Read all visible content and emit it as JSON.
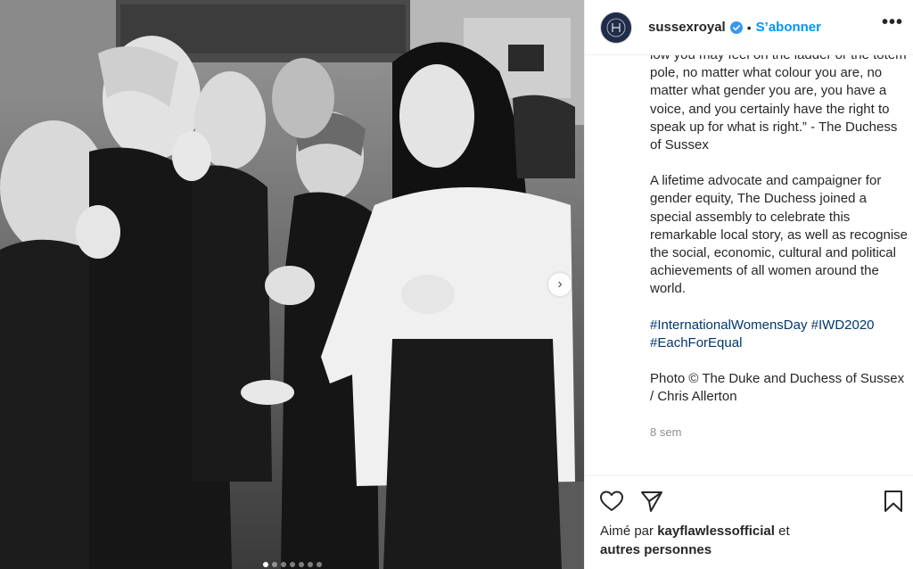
{
  "post": {
    "username": "sussexroyal",
    "separator": "•",
    "follow_label": "S’abonner",
    "more_label": "•••",
    "next_label": "›"
  },
  "caption": {
    "line_top": "low you may feel on the ladder or the totem pole, no matter what colour you are, no matter what gender you are, you have a voice, and you certainly have the right to speak up for what is right.” - The Duchess of Sussex",
    "paragraph_2": "A lifetime advocate and campaigner for gender equity, The Duchess joined a special assembly to celebrate this remarkable local story, as well as recognise the social, economic, cultural and political achievements of all women around the world.",
    "hashtags": [
      "#InternationalWomensDay",
      "#IWD2020",
      "#EachForEqual"
    ],
    "credit": "Photo © The Duke and Duchess of Sussex / Chris Allerton",
    "time": "8 sem"
  },
  "likes": {
    "prefix": "Aimé par",
    "user": "kayflawlessofficial",
    "suffix": "et",
    "others": "autres personnes"
  },
  "icons": {
    "like": "heart-icon",
    "share": "paper-plane-icon",
    "save": "bookmark-icon",
    "verified": "verified-badge-icon",
    "next": "chevron-right-icon"
  },
  "carousel": {
    "count": 7,
    "active_index": 1
  },
  "colors": {
    "link": "#0095f6",
    "hashtag": "#00376b",
    "muted": "#8e8e8e",
    "text": "#262626"
  }
}
